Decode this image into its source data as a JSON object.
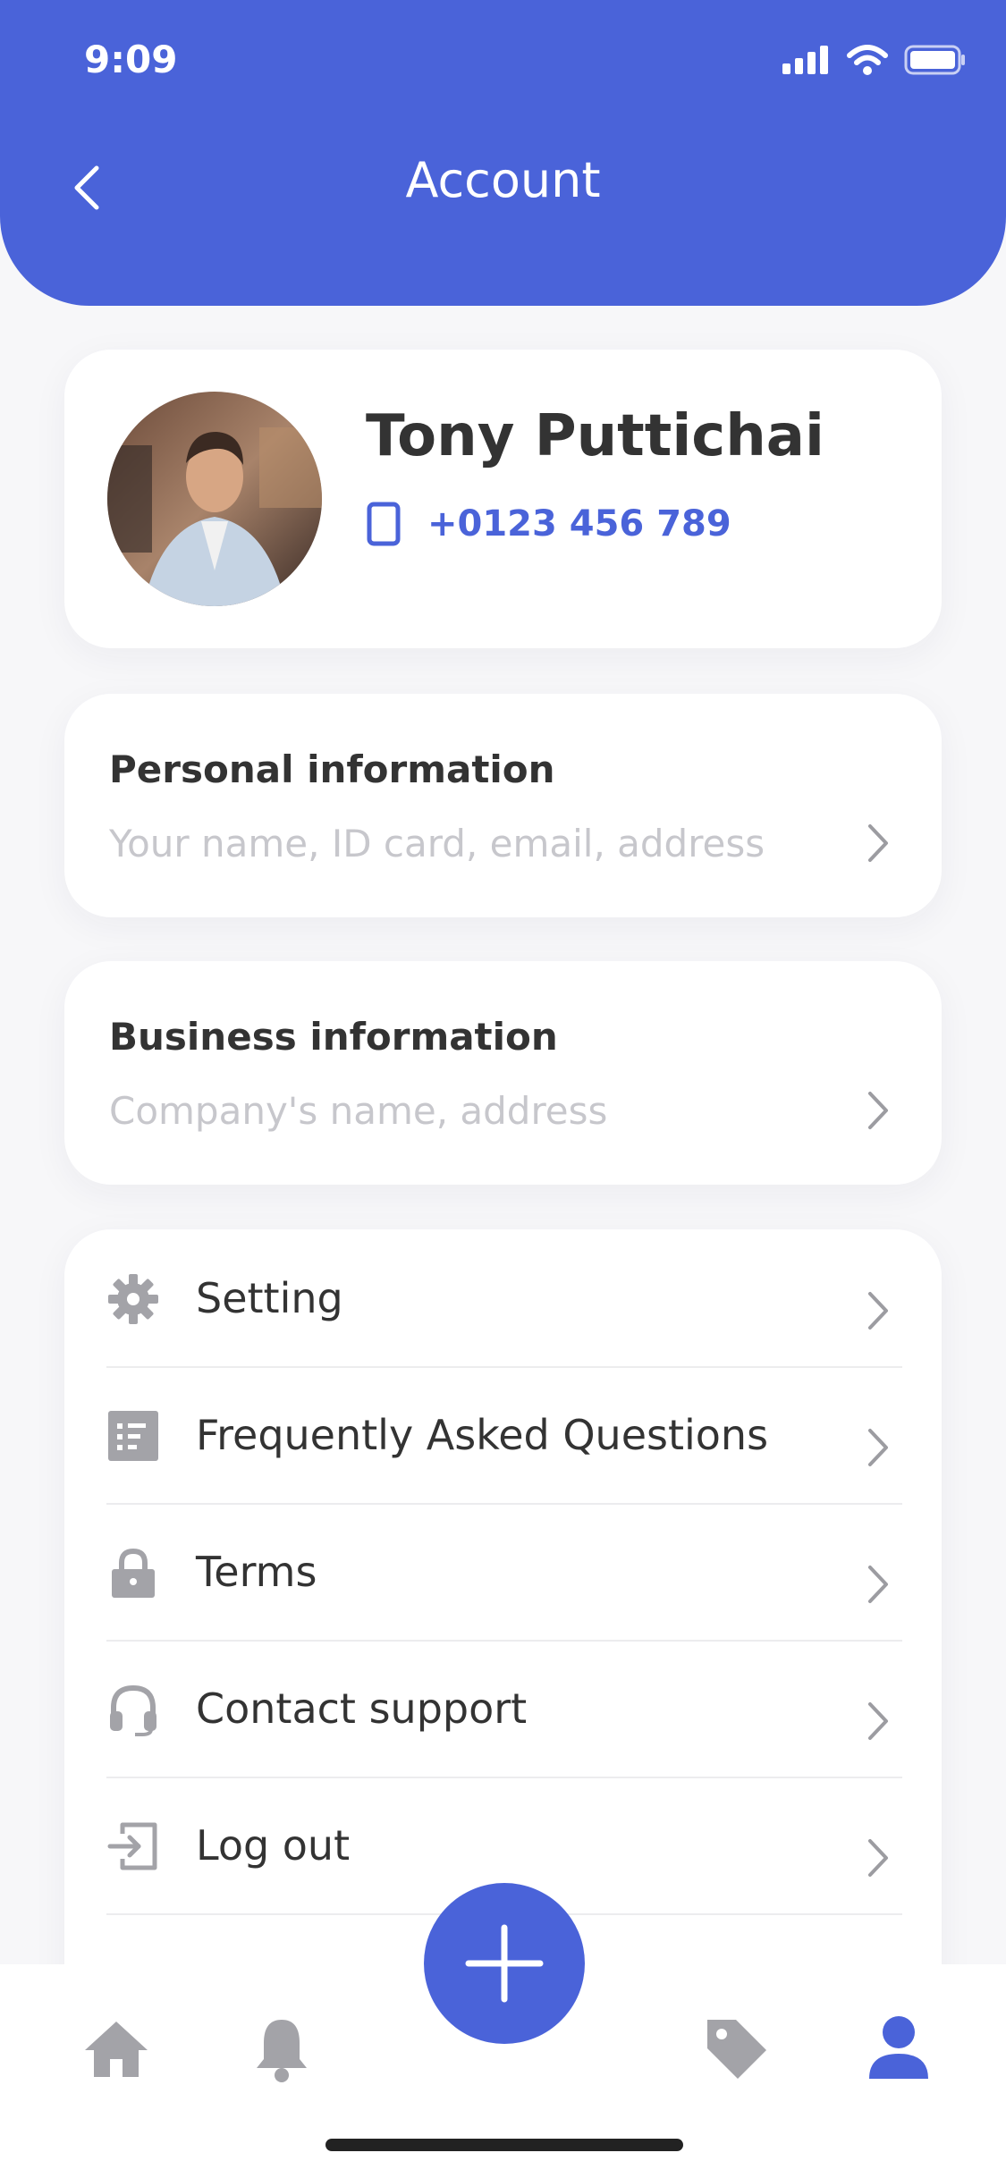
{
  "status_bar": {
    "time": "9:09"
  },
  "header": {
    "title": "Account"
  },
  "profile": {
    "name": "Tony Puttichai",
    "phone": "+0123 456 789"
  },
  "personal_info": {
    "title": "Personal information",
    "subtitle": "Your name, ID card, email, address"
  },
  "business_info": {
    "title": "Business information",
    "subtitle": "Company's name, address"
  },
  "menu": {
    "items": [
      {
        "label": "Setting",
        "icon": "gear-icon"
      },
      {
        "label": "Frequently Asked Questions",
        "icon": "faq-icon"
      },
      {
        "label": "Terms",
        "icon": "lock-icon"
      },
      {
        "label": "Contact support",
        "icon": "headset-icon"
      },
      {
        "label": "Log out",
        "icon": "logout-icon"
      }
    ]
  },
  "bottom_nav": {
    "items": [
      {
        "icon": "home-icon"
      },
      {
        "icon": "bell-icon"
      },
      {
        "icon": "add-icon"
      },
      {
        "icon": "tag-icon"
      },
      {
        "icon": "user-icon"
      }
    ]
  },
  "colors": {
    "accent": "#4a63d9",
    "icon_gray": "#a3a3a8",
    "text": "#333333",
    "muted": "#c7c7cc"
  }
}
